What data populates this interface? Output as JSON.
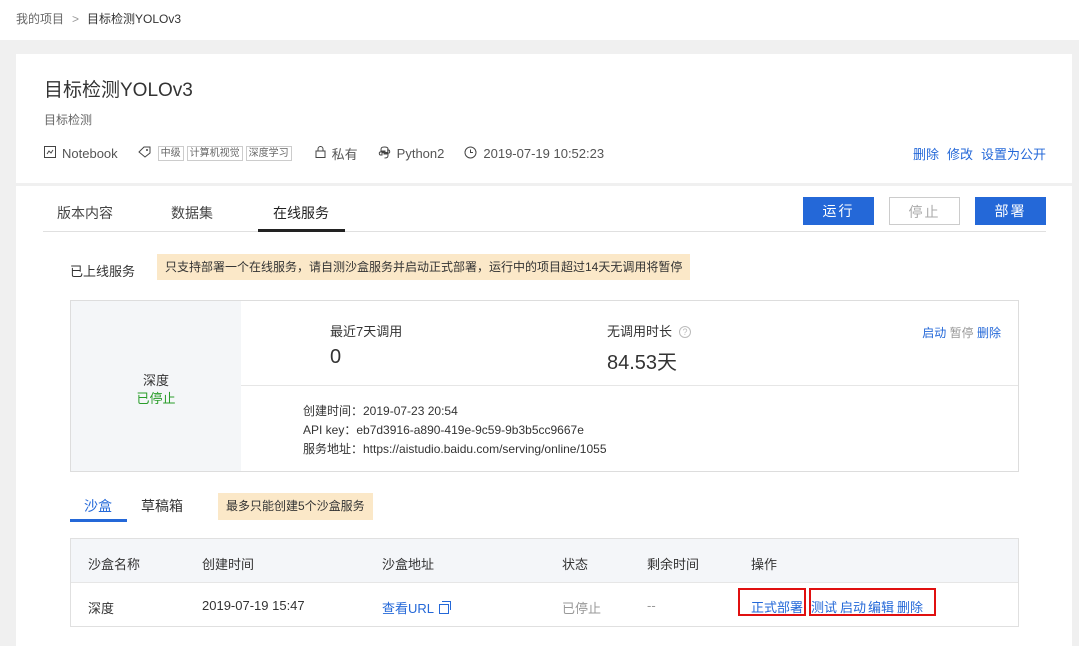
{
  "breadcrumb": {
    "root": "我的项目",
    "separator": ">",
    "current": "目标检测YOLOv3"
  },
  "project": {
    "title": "目标检测YOLOv3",
    "subtitle": "目标检测",
    "meta": {
      "type": "Notebook",
      "tags": [
        "中级",
        "计算机视觉",
        "深度学习"
      ],
      "visibility": "私有",
      "env": "Python2",
      "created": "2019-07-19 10:52:23"
    },
    "actions": [
      "删除",
      "修改",
      "设置为公开"
    ]
  },
  "tabs": [
    "版本内容",
    "数据集",
    "在线服务"
  ],
  "active_tab": "在线服务",
  "buttons": {
    "run": "运行",
    "stop": "停止",
    "deploy": "部署"
  },
  "online": {
    "label": "已上线服务",
    "notice": "只支持部署一个在线服务，请自测沙盒服务并启动正式部署，运行中的项目超过14天无调用将暂停"
  },
  "service": {
    "name": "深度",
    "status": "已停止",
    "calls_label": "最近7天调用",
    "calls_value": "0",
    "idle_label": "无调用时长",
    "idle_value": "84.53天",
    "actions": {
      "start": "启动",
      "pause": "暂停",
      "delete": "删除"
    },
    "created_line": "创建时间：2019-07-23 20:54",
    "apikey_line": "API key：eb7d3916-a890-419e-9c59-9b3b5cc9667e",
    "url_line": "服务地址：https://aistudio.baidu.com/serving/online/1055"
  },
  "sandbox_tabs": [
    "沙盒",
    "草稿箱"
  ],
  "sandbox_notice": "最多只能创建5个沙盒服务",
  "table": {
    "headers": [
      "沙盒名称",
      "创建时间",
      "沙盒地址",
      "状态",
      "剩余时间",
      "操作"
    ],
    "row": {
      "name": "深度",
      "created": "2019-07-19 15:47",
      "url_text": "查看URL",
      "status": "已停止",
      "remaining": "--",
      "ops": {
        "deploy": "正式部署",
        "test": "测试",
        "start": "启动",
        "edit": "编辑",
        "delete": "删除"
      }
    }
  },
  "colors": {
    "accent": "#2468d8",
    "notice_bg": "#fbe8c8",
    "stopped": "#2a9d2a",
    "highlight": "#e01010"
  }
}
